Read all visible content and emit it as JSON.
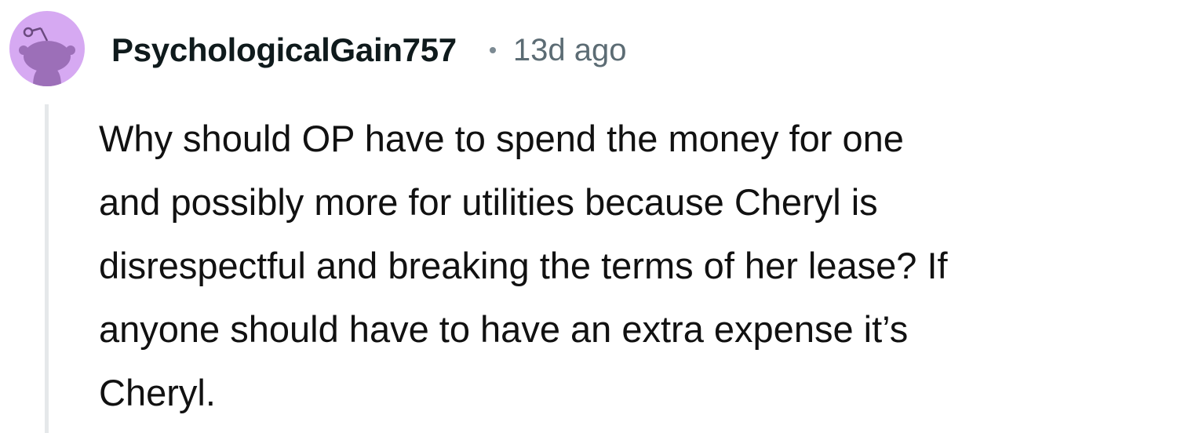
{
  "comment": {
    "author": "PsychologicalGain757",
    "separator_icon": "dot-icon",
    "age": "13d ago",
    "avatar": {
      "icon": "snoo-avatar-icon",
      "background_color": "#d6a9f2",
      "figure_color": "#9c6fb8"
    },
    "body_lines": [
      "Why should OP have to spend the money for one",
      "and possibly more for utilities because Cheryl is",
      "disrespectful and breaking the terms of her lease? If",
      "anyone should have to have an extra expense it’s",
      "Cheryl."
    ]
  }
}
